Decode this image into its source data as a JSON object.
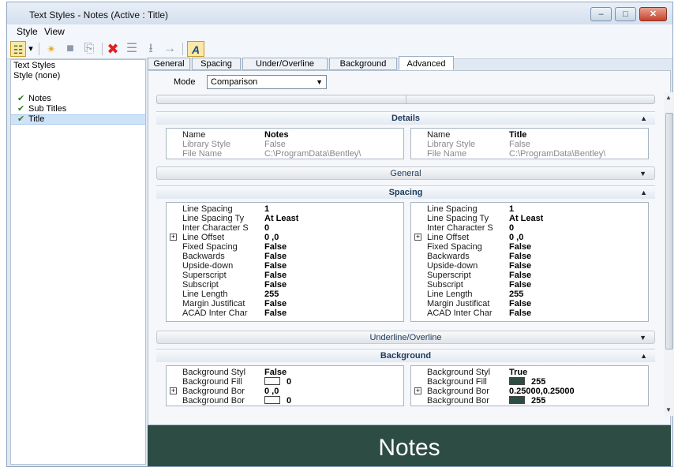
{
  "window": {
    "title": "Text Styles - Notes (Active : Title)",
    "min_glyph": "–",
    "max_glyph": "□",
    "close_glyph": "✕"
  },
  "menu": {
    "style": "Style",
    "view": "View"
  },
  "toolbar": {
    "icons": [
      "hierarchy-view-icon",
      "dropdown-arrow-icon",
      "new-style-icon",
      "save-icon",
      "copy-icon",
      "delete-icon",
      "rename-icon",
      "import-icon",
      "export-icon",
      "find-text-icon"
    ],
    "glyphs": {
      "tree": "☷",
      "drop": "▾",
      "new": "✴",
      "save": "■",
      "copy": "⎘",
      "delete": "✖",
      "rename": "☰",
      "import": "⭳",
      "export": "→",
      "find": "A"
    }
  },
  "left_panel": {
    "header": "Text Styles",
    "style_none": "Style (none)",
    "styles": [
      {
        "label": "Notes",
        "checked": true
      },
      {
        "label": "Sub Titles",
        "checked": true
      },
      {
        "label": "Title",
        "checked": true
      }
    ]
  },
  "tabs": [
    "General",
    "Spacing",
    "Under/Overline",
    "Background",
    "Advanced"
  ],
  "active_tab": "Advanced",
  "mode": {
    "label": "Mode",
    "value": "Comparison"
  },
  "sections": {
    "details": {
      "title": "Details"
    },
    "general": {
      "title": "General"
    },
    "spacing": {
      "title": "Spacing"
    },
    "underline": {
      "title": "Underline/Overline"
    },
    "background": {
      "title": "Background"
    }
  },
  "details": {
    "left": [
      {
        "k": "Name",
        "v": "Notes",
        "dim": false
      },
      {
        "k": "Library Style",
        "v": "False",
        "dim": true
      },
      {
        "k": "File Name",
        "v": "C:\\ProgramData\\Bentley\\",
        "dim": true
      }
    ],
    "right": [
      {
        "k": "Name",
        "v": "Title",
        "dim": false
      },
      {
        "k": "Library Style",
        "v": "False",
        "dim": true
      },
      {
        "k": "File Name",
        "v": "C:\\ProgramData\\Bentley\\",
        "dim": true
      }
    ]
  },
  "spacing": {
    "left": [
      {
        "k": "Line Spacing",
        "v": "1"
      },
      {
        "k": "Line Spacing Ty",
        "v": "At Least"
      },
      {
        "k": "Inter Character S",
        "v": "0"
      },
      {
        "k": "Line Offset",
        "v": "0      ,0",
        "exp": true
      },
      {
        "k": "Fixed Spacing",
        "v": "False"
      },
      {
        "k": "Backwards",
        "v": "False"
      },
      {
        "k": "Upside-down",
        "v": "False"
      },
      {
        "k": "Superscript",
        "v": "False"
      },
      {
        "k": "Subscript",
        "v": "False"
      },
      {
        "k": "Line Length",
        "v": "255"
      },
      {
        "k": "Margin Justificat",
        "v": "False"
      },
      {
        "k": "ACAD Inter Char",
        "v": "False"
      }
    ],
    "right": [
      {
        "k": "Line Spacing",
        "v": "1"
      },
      {
        "k": "Line Spacing Ty",
        "v": "At Least"
      },
      {
        "k": "Inter Character S",
        "v": "0"
      },
      {
        "k": "Line Offset",
        "v": "0      ,0",
        "exp": true
      },
      {
        "k": "Fixed Spacing",
        "v": "False"
      },
      {
        "k": "Backwards",
        "v": "False"
      },
      {
        "k": "Upside-down",
        "v": "False"
      },
      {
        "k": "Superscript",
        "v": "False"
      },
      {
        "k": "Subscript",
        "v": "False"
      },
      {
        "k": "Line Length",
        "v": "255"
      },
      {
        "k": "Margin Justificat",
        "v": "False"
      },
      {
        "k": "ACAD Inter Char",
        "v": "False"
      }
    ]
  },
  "background": {
    "left": [
      {
        "k": "Background Styl",
        "v": "False"
      },
      {
        "k": "Background Fill",
        "v": "0",
        "swatch": "#ffffff"
      },
      {
        "k": "Background Bor",
        "v": "0      ,0",
        "exp": true
      },
      {
        "k": "Background Bor",
        "v": "0",
        "swatch": "#ffffff"
      }
    ],
    "right": [
      {
        "k": "Background Styl",
        "v": "True"
      },
      {
        "k": "Background Fill",
        "v": "255",
        "swatch": "#2d4c44"
      },
      {
        "k": "Background Bor",
        "v": "0.25000,0.25000",
        "exp": true
      },
      {
        "k": "Background Bor",
        "v": "255",
        "swatch": "#2d4c44"
      }
    ]
  },
  "preview": {
    "text": "Notes",
    "bg": "#2d4c44"
  }
}
